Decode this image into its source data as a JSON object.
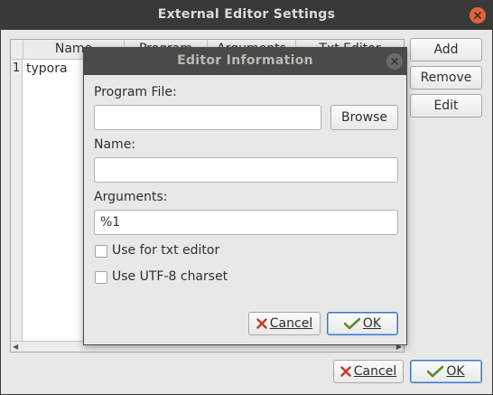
{
  "outer_window": {
    "title": "External Editor Settings",
    "table": {
      "columns": [
        "Name",
        "Program",
        "Arguments",
        "Txt Editor"
      ],
      "rows": [
        {
          "num": "1",
          "name": "typora"
        }
      ]
    },
    "buttons": {
      "add": "Add",
      "remove": "Remove",
      "edit": "Edit",
      "cancel": "Cancel",
      "ok": "OK"
    }
  },
  "dialog": {
    "title": "Editor Information",
    "program_file_label": "Program File:",
    "program_file_value": "",
    "browse_label": "Browse",
    "name_label": "Name:",
    "name_value": "",
    "arguments_label": "Arguments:",
    "arguments_value": "%1",
    "txt_editor_label": "Use for txt editor",
    "txt_editor_checked": false,
    "utf8_label": "Use UTF-8 charset",
    "utf8_checked": false,
    "cancel_label": "Cancel",
    "ok_label": "OK"
  },
  "colors": {
    "titlebar": "#393935",
    "close_button": "#e0643c",
    "window_bg": "#e8e8e7",
    "focus_border": "#3a78c9"
  }
}
